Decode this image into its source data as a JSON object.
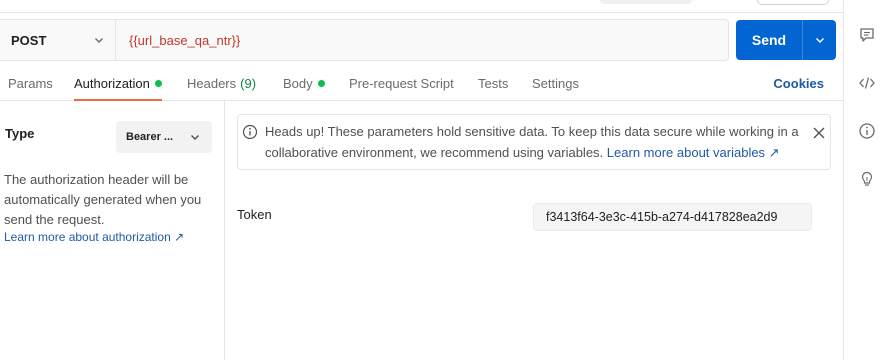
{
  "request": {
    "method": "POST",
    "url": "{{url_base_qa_ntr}}",
    "send_label": "Send"
  },
  "tabs": [
    {
      "label": "Params"
    },
    {
      "label": "Authorization",
      "indicator": "green-dot"
    },
    {
      "label": "Headers",
      "count": "(9)"
    },
    {
      "label": "Body",
      "indicator": "green-dot"
    },
    {
      "label": "Pre-request Script"
    },
    {
      "label": "Tests"
    },
    {
      "label": "Settings"
    }
  ],
  "cookies_label": "Cookies",
  "auth": {
    "type_label": "Type",
    "type_value": "Bearer ...",
    "description": "The authorization header will be automatically generated when you send the request.",
    "learn_more": "Learn more about authorization ↗"
  },
  "banner": {
    "text": "Heads up! These parameters hold sensitive data. To keep this data secure while working in a collaborative environment, we recommend using variables.",
    "link": "Learn more about variables ↗"
  },
  "token": {
    "label": "Token",
    "value": "f3413f64-3e3c-415b-a274-d417828ea2d9"
  },
  "sidebar_icons": [
    "comment-icon",
    "code-icon",
    "info-icon",
    "lightbulb-icon"
  ],
  "colors": {
    "accent_send": "#0265d2",
    "active_tab_underline": "#f26b3a",
    "indicator_green": "#0cbb52",
    "link_blue": "#1f5aa6",
    "url_variable": "#c0392b"
  }
}
